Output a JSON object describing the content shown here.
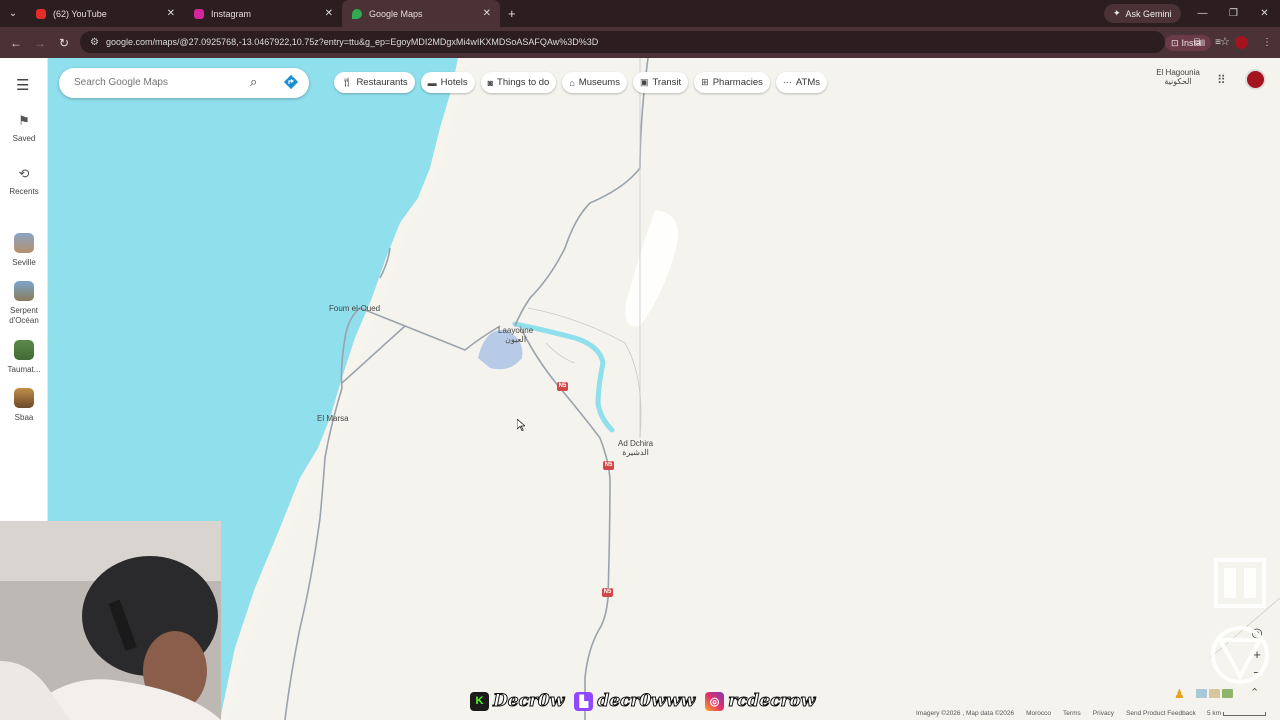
{
  "browser": {
    "tabs": [
      {
        "label": "(62) YouTube",
        "color": "#e52d27"
      },
      {
        "label": "Instagram",
        "color": "#d6249f"
      },
      {
        "label": "Google Maps",
        "color": "#34a853"
      }
    ],
    "gemini_label": "Ask Gemini",
    "url": "google.com/maps/@27.0925768,-13.0467922,10.75z?entry=ttu&g_ep=EgoyMDI2MDgxMi4wIKXMDSoASAFQAw%3D%3D",
    "install_label": "Install"
  },
  "sidebar": {
    "saved_label": "Saved",
    "recents_label": "Recents",
    "recent_places": [
      {
        "label": "Seville"
      },
      {
        "label": "Serpent d'Océan"
      },
      {
        "label": "Taumat..."
      },
      {
        "label": "Sbaa"
      }
    ]
  },
  "search": {
    "placeholder": "Search Google Maps"
  },
  "chips": [
    {
      "label": "Restaurants",
      "icon": "fork-knife-icon"
    },
    {
      "label": "Hotels",
      "icon": "bed-icon"
    },
    {
      "label": "Things to do",
      "icon": "camera-icon"
    },
    {
      "label": "Museums",
      "icon": "museum-icon"
    },
    {
      "label": "Transit",
      "icon": "train-icon"
    },
    {
      "label": "Pharmacies",
      "icon": "pharmacy-icon"
    },
    {
      "label": "ATMs",
      "icon": "atm-icon"
    }
  ],
  "header_location": {
    "name": "El Hagounia",
    "name_ar": "الحكونية"
  },
  "map": {
    "places": {
      "foum": "Foum el-Oued",
      "laayoune": "Laayoune",
      "laayoune_ar": "العيون",
      "elmarsa": "El Marsa",
      "addchira": "Ad Dchira",
      "addchira_ar": "الدشيرة"
    },
    "road_shield": "N5"
  },
  "footer": {
    "imagery": "Imagery ©2026 , Map data ©2026",
    "country": "Morocco",
    "terms": "Terms",
    "privacy": "Privacy",
    "feedback": "Send Product Feedback",
    "scale": "5 km"
  },
  "overlay": {
    "handle1": "Decr0w",
    "handle2": "decr0www",
    "handle3": "rcdecrow"
  }
}
